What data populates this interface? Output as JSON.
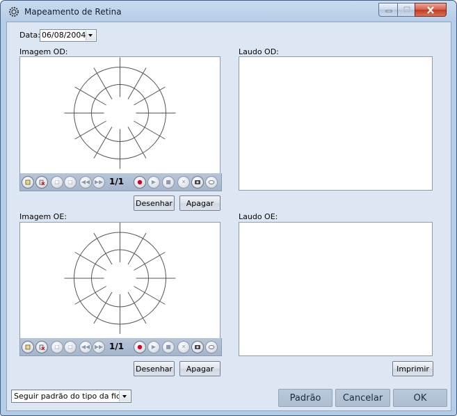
{
  "window": {
    "title": "Mapeamento de Retina",
    "icon": "gear-app-icon"
  },
  "date": {
    "label": "Data:",
    "value": "06/08/2004"
  },
  "od": {
    "image_label": "Imagem OD:",
    "report_label": "Laudo OD:",
    "report_text": "",
    "counter": "1/1",
    "draw_button": "Desenhar",
    "erase_button": "Apagar"
  },
  "oe": {
    "image_label": "Imagem OE:",
    "report_label": "Laudo OE:",
    "report_text": "",
    "counter": "1/1",
    "draw_button": "Desenhar",
    "erase_button": "Apagar"
  },
  "print_button": "Imprimir",
  "template_select": {
    "value": "Seguir padrão do tipo da ficha"
  },
  "footer": {
    "default_button": "Padrão",
    "cancel_button": "Cancelar",
    "ok_button": "OK"
  },
  "colors": {
    "title_bg": "#b5cce6",
    "client_bg": "#dde7f3",
    "record_red": "#d8001c",
    "diagram_stroke": "#555555"
  }
}
